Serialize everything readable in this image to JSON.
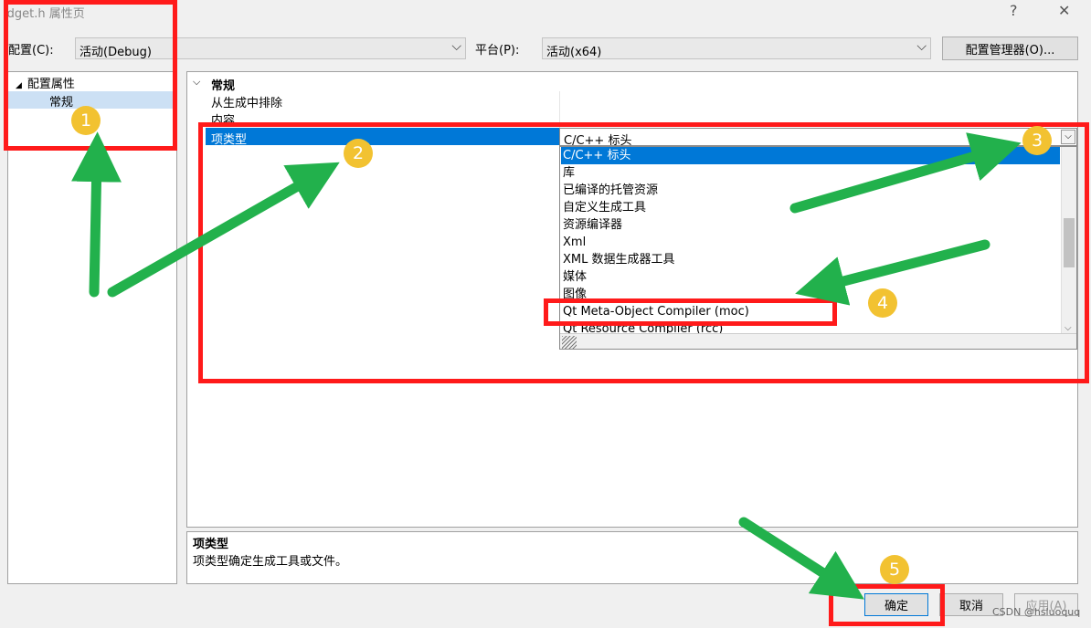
{
  "window": {
    "title": "idget.h 属性页",
    "help_label": "?",
    "close_label": "✕"
  },
  "toolbar": {
    "config_label": "配置(C):",
    "config_value": "活动(Debug)",
    "platform_label": "平台(P):",
    "platform_value": "活动(x64)",
    "config_manager_label": "配置管理器(O)..."
  },
  "tree": {
    "root_label": "配置属性",
    "child_label": "常规"
  },
  "grid": {
    "section_title": "常规",
    "rows": [
      {
        "name": "从生成中排除",
        "value": ""
      },
      {
        "name": "内容",
        "value": ""
      },
      {
        "name": "项类型",
        "value": "C/C++ 标头"
      }
    ]
  },
  "dropdown": {
    "items": [
      "C/C++ 标头",
      "库",
      "已编译的托管资源",
      "自定义生成工具",
      "资源编译器",
      "Xml",
      "XML 数据生成器工具",
      "媒体",
      "图像",
      "Qt Meta-Object Compiler (moc)",
      "Qt Resource Compiler (rcc)"
    ],
    "selected_index": 0
  },
  "description": {
    "title": "项类型",
    "text": "项类型确定生成工具或文件。"
  },
  "buttons": {
    "ok": "确定",
    "cancel": "取消",
    "apply": "应用(A)"
  },
  "watermark": "CSDN @hsluoquq",
  "annotations": {
    "badges": [
      "1",
      "2",
      "3",
      "4",
      "5"
    ],
    "box_color": "#ff1a1a",
    "arrow_color": "#22b14c",
    "badge_color": "#f2c231"
  }
}
